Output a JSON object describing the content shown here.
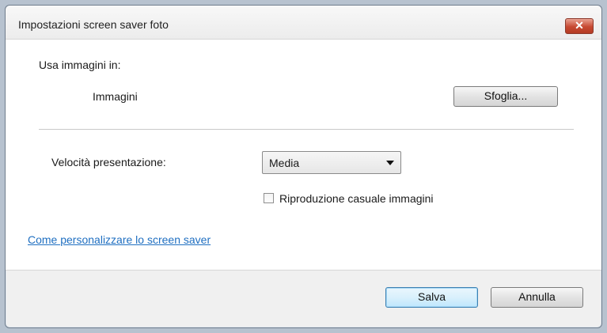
{
  "window": {
    "title": "Impostazioni screen saver foto",
    "close_label": "✕"
  },
  "folder": {
    "label": "Usa immagini in:",
    "path": "Immagini",
    "browse_label": "Sfoglia..."
  },
  "speed": {
    "label": "Velocità presentazione:",
    "selected": "Media"
  },
  "shuffle": {
    "label": "Riproduzione casuale immagini",
    "checked": false
  },
  "help_link": "Come personalizzare lo screen saver",
  "footer": {
    "save_label": "Salva",
    "cancel_label": "Annulla"
  },
  "colors": {
    "link": "#1f6fc1",
    "close_button": "#c74a32",
    "default_button_border": "#3c7fb1"
  },
  "icons": {
    "close": "close-icon",
    "dropdown": "chevron-down-icon"
  }
}
